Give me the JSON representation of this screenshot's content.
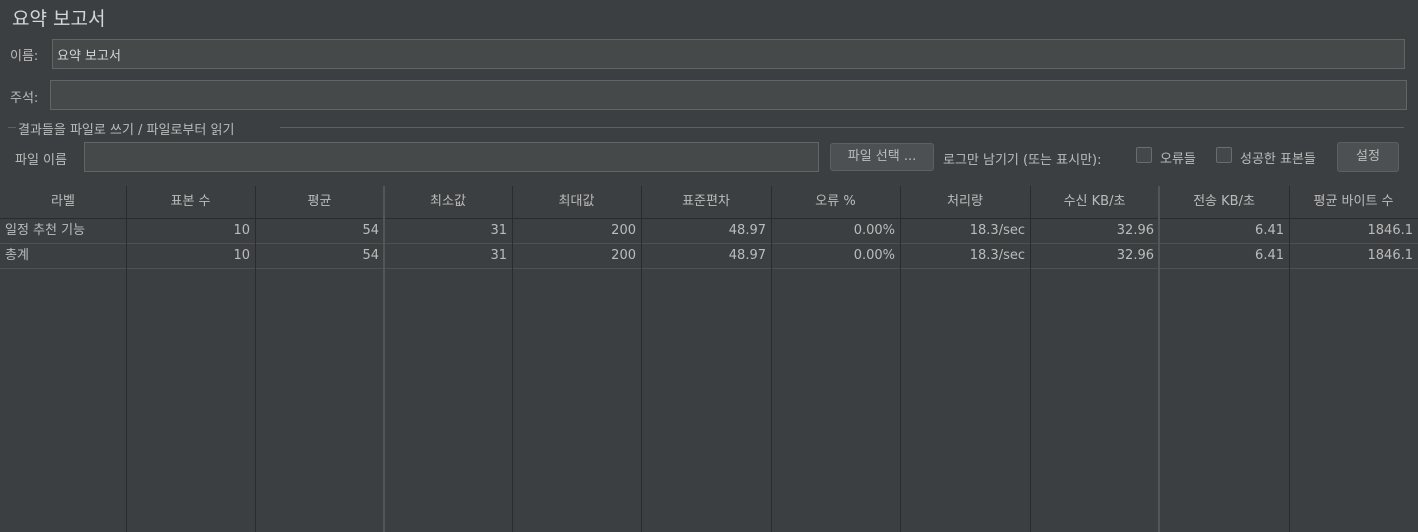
{
  "panel": {
    "title": "요약 보고서",
    "name_label": "이름:",
    "name_value": "요약 보고서",
    "comment_label": "주석:",
    "comment_value": ""
  },
  "file_group": {
    "title": "결과들을 파일로 쓰기 / 파일로부터 읽기",
    "filename_label": "파일 이름",
    "filename_value": "",
    "browse_button": "파일 선택 ...",
    "log_only_label": "로그만 남기기 (또는 표시만):",
    "errors_label": "오류들",
    "errors_checked": false,
    "success_label": "성공한 표본들",
    "success_checked": false,
    "configure_button": "설정"
  },
  "table": {
    "columns": [
      "라벨",
      "표본 수",
      "평균",
      "최소값",
      "최대값",
      "표준편차",
      "오류 %",
      "처리량",
      "수신 KB/초",
      "전송 KB/초",
      "평균 바이트 수"
    ],
    "rows": [
      [
        "일정 추천 기능",
        "10",
        "54",
        "31",
        "200",
        "48.97",
        "0.00%",
        "18.3/sec",
        "32.96",
        "6.41",
        "1846.1"
      ],
      [
        "총계",
        "10",
        "54",
        "31",
        "200",
        "48.97",
        "0.00%",
        "18.3/sec",
        "32.96",
        "6.41",
        "1846.1"
      ]
    ]
  }
}
